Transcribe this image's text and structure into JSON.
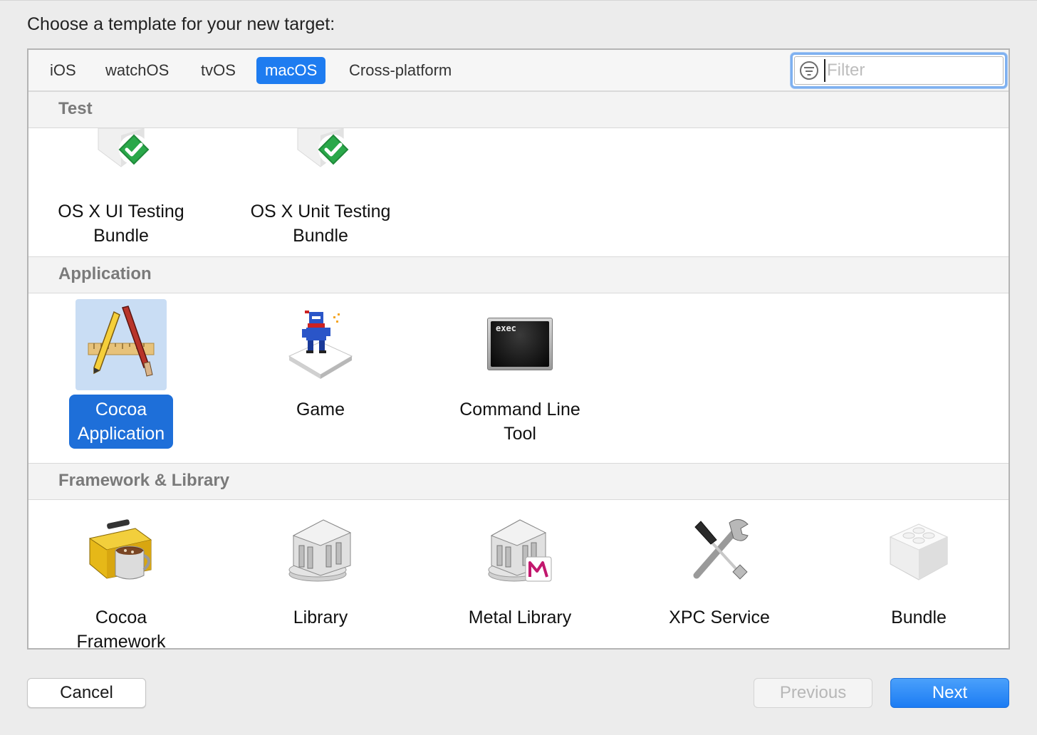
{
  "prompt": "Choose a template for your new target:",
  "tabs": [
    {
      "label": "iOS",
      "active": false
    },
    {
      "label": "watchOS",
      "active": false
    },
    {
      "label": "tvOS",
      "active": false
    },
    {
      "label": "macOS",
      "active": true
    },
    {
      "label": "Cross-platform",
      "active": false
    }
  ],
  "filter": {
    "placeholder": "Filter",
    "value": ""
  },
  "sections": [
    {
      "title": "Test",
      "items": [
        {
          "label_line1": "OS X UI Testing",
          "label_line2": "Bundle",
          "icon": "ui-testing-bundle-icon"
        },
        {
          "label_line1": "OS X Unit Testing",
          "label_line2": "Bundle",
          "icon": "unit-testing-bundle-icon"
        }
      ]
    },
    {
      "title": "Application",
      "items": [
        {
          "label_line1": "Cocoa",
          "label_line2": "Application",
          "icon": "cocoa-application-icon",
          "selected": true
        },
        {
          "label_line1": "Game",
          "label_line2": "",
          "icon": "game-icon"
        },
        {
          "label_line1": "Command Line",
          "label_line2": "Tool",
          "icon": "command-line-tool-icon",
          "icon_text": "exec"
        }
      ]
    },
    {
      "title": "Framework & Library",
      "items": [
        {
          "label_line1": "Cocoa",
          "label_line2": "Framework",
          "icon": "cocoa-framework-icon"
        },
        {
          "label_line1": "Library",
          "label_line2": "",
          "icon": "library-icon"
        },
        {
          "label_line1": "Metal Library",
          "label_line2": "",
          "icon": "metal-library-icon"
        },
        {
          "label_line1": "XPC Service",
          "label_line2": "",
          "icon": "xpc-service-icon"
        },
        {
          "label_line1": "Bundle",
          "label_line2": "",
          "icon": "bundle-icon"
        }
      ]
    }
  ],
  "buttons": {
    "cancel": "Cancel",
    "previous": "Previous",
    "next": "Next"
  },
  "colors": {
    "accent": "#1e7cf0",
    "selection": "#1e6fd9",
    "section_header_text": "#7a7a7a"
  }
}
